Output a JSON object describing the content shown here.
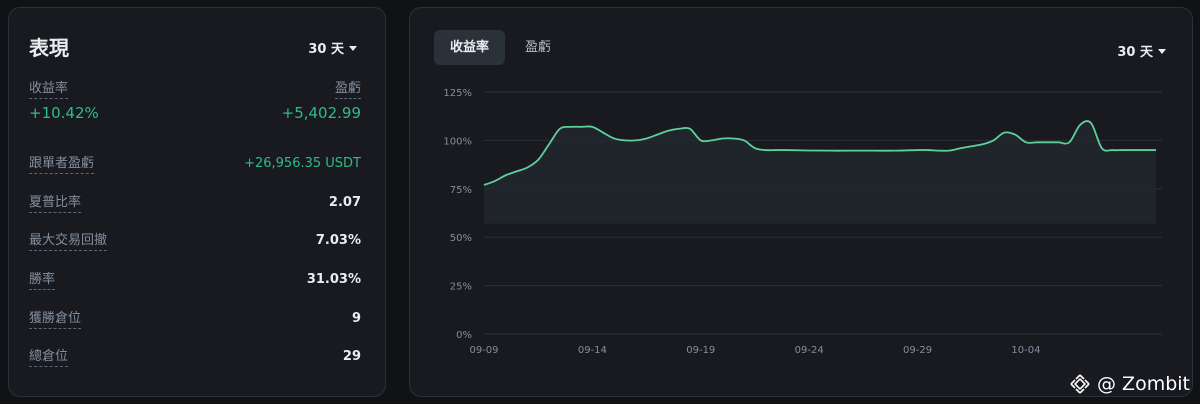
{
  "performance": {
    "title": "表現",
    "range": "30 天",
    "roi_label": "收益率",
    "pnl_label": "盈虧",
    "roi_value": "+10.42%",
    "pnl_value": "+5,402.99",
    "stats": [
      {
        "label": "跟單者盈虧",
        "value": "+26,956.35 USDT",
        "green": true
      },
      {
        "label": "夏普比率",
        "value": "2.07",
        "green": false
      },
      {
        "label": "最大交易回撤",
        "value": "7.03%",
        "green": false
      },
      {
        "label": "勝率",
        "value": "31.03%",
        "green": false
      },
      {
        "label": "獲勝倉位",
        "value": "9",
        "green": false
      },
      {
        "label": "總倉位",
        "value": "29",
        "green": false
      }
    ]
  },
  "chart_panel": {
    "tabs": [
      {
        "label": "收益率",
        "active": true
      },
      {
        "label": "盈虧",
        "active": false
      }
    ],
    "range": "30 天"
  },
  "colors": {
    "positive": "#2ebd85",
    "line": "#5fd09a",
    "card_bg": "#181a20",
    "page_bg": "#101216"
  },
  "chart_data": {
    "type": "area",
    "y_ticks": [
      "125%",
      "100%",
      "75%",
      "50%",
      "25%",
      "0%"
    ],
    "y_tick_values": [
      125,
      100,
      75,
      50,
      25,
      0
    ],
    "ylim": [
      0,
      125
    ],
    "x_ticks": [
      "09-09",
      "09-14",
      "09-19",
      "09-24",
      "09-29",
      "10-04"
    ],
    "grid": true,
    "series": [
      {
        "x": [
          0,
          0.5,
          1,
          1.5,
          2,
          2.5,
          3,
          3.5,
          4,
          4.5,
          5,
          5.5,
          6,
          6.5,
          7,
          7.5,
          8,
          8.5,
          9,
          9.5,
          10,
          10.5,
          11,
          11.5,
          12,
          12.5,
          13,
          13.5,
          14,
          15,
          16,
          17,
          18,
          19,
          20,
          20.5,
          21,
          21.5,
          22,
          22.5,
          23,
          23.5,
          24,
          24.5,
          25,
          25.5,
          26,
          26.5,
          27,
          27.5,
          28,
          28.5,
          29,
          29.5,
          30,
          30.5,
          31
        ],
        "y": [
          77,
          79,
          82,
          84,
          86,
          90,
          98,
          106,
          107,
          107,
          107,
          104,
          101,
          100,
          100,
          101,
          103,
          105,
          106,
          106,
          100,
          100,
          101,
          101,
          100,
          96,
          95,
          95,
          95,
          94.8,
          94.7,
          94.7,
          94.7,
          94.7,
          95,
          95,
          94.7,
          94.8,
          96,
          97,
          98,
          100,
          104,
          103,
          99,
          99,
          99,
          99,
          99,
          108,
          109,
          96,
          95,
          95,
          95,
          95,
          95
        ]
      }
    ]
  },
  "watermark": {
    "text": "@ Zombit",
    "icon": "binance-diamond-icon"
  }
}
